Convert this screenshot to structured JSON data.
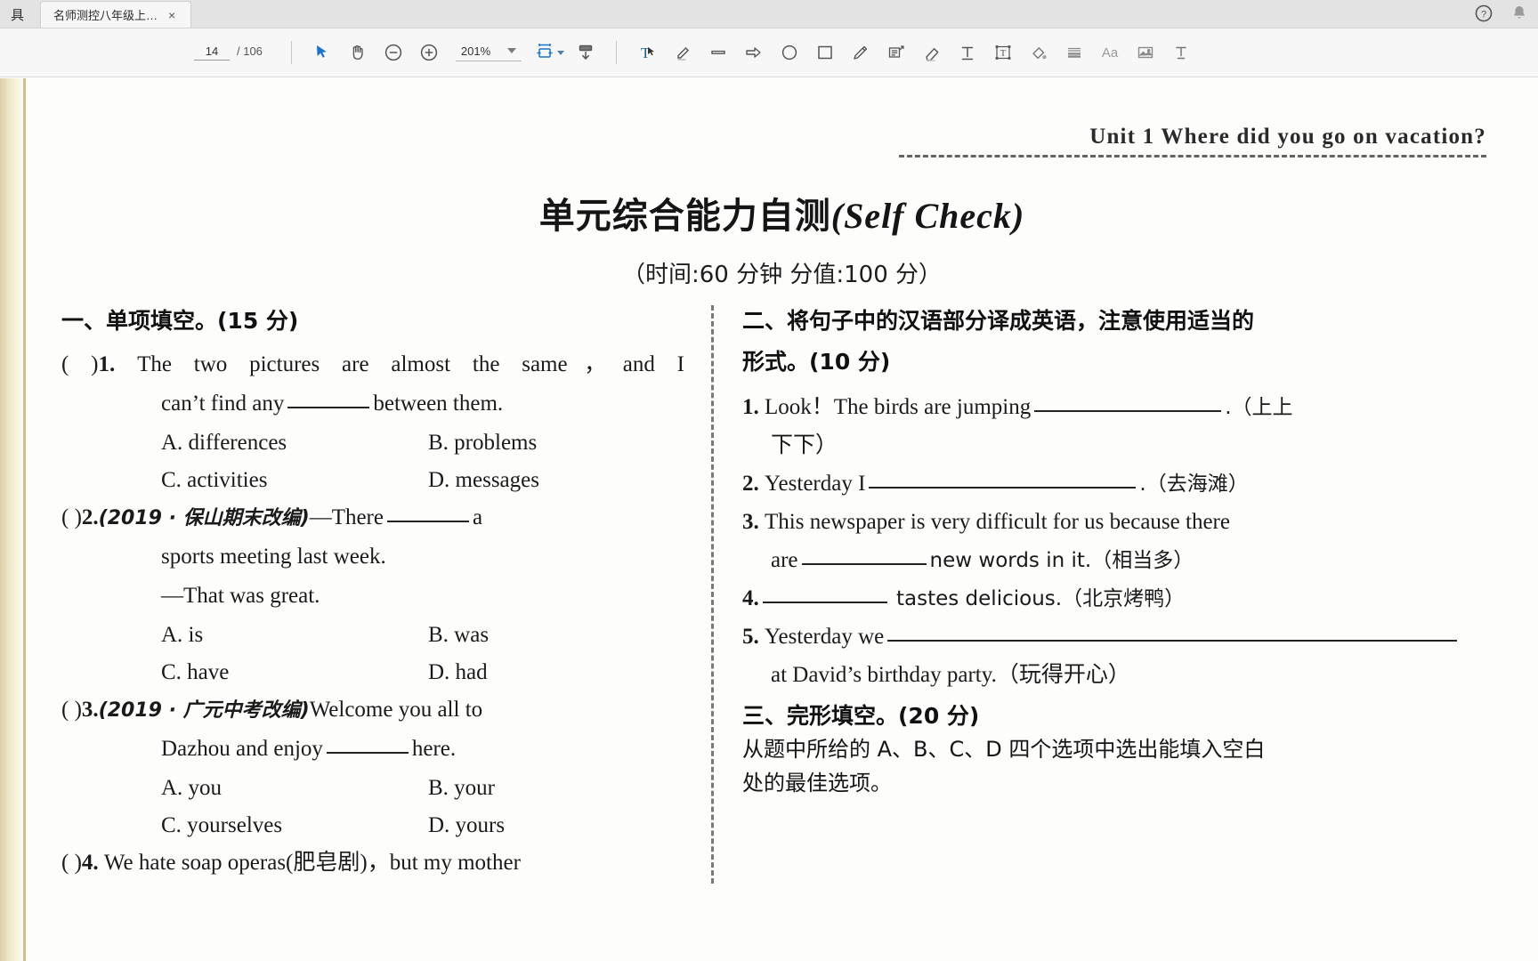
{
  "window": {
    "menu_tail": "具",
    "tab_title": "名师测控八年级上…",
    "tab_close": "×",
    "help_icon": "help-circle-icon",
    "bell_icon": "bell-icon"
  },
  "toolbar": {
    "page_current": "14",
    "page_total": "/ 106",
    "zoom_value": "201%",
    "icons": [
      "select-cursor-icon",
      "hand-pan-icon",
      "zoom-out-icon",
      "zoom-in-icon",
      "fit-page-icon",
      "download-icon",
      "text-select-icon",
      "highlighter-icon",
      "line-icon",
      "arrow-icon",
      "ellipse-icon",
      "rectangle-icon",
      "pencil-icon",
      "note-callout-icon",
      "eraser-icon",
      "text-insert-icon",
      "text-box-icon",
      "fill-color-icon",
      "strikethrough-lines-icon",
      "font-size-icon",
      "image-insert-icon",
      "text-underline-icon"
    ]
  },
  "document": {
    "header_unit": "Unit 1    Where did you go on vacation?",
    "title_cn": "单元综合能力自测",
    "title_en": "Self Check",
    "title_open_paren": "(",
    "title_close_paren": ")",
    "subtitle": "（时间:60 分钟    分值:100 分）",
    "left_column": {
      "section_heading": "一、单项填空。(15 分)",
      "questions": [
        {
          "marker": "(      )",
          "num": "1.",
          "line1": "The  two  pictures  are  almost  the  same，and  I",
          "line2_pre": "can’t find any",
          "line2_post": "between them.",
          "options": [
            "A. differences",
            "B. problems",
            "C. activities",
            "D. messages"
          ]
        },
        {
          "marker": "(      )",
          "num": "2.",
          "source": "(2019 · 保山期末改编)",
          "line1_pre": "—There",
          "line1_post": "a",
          "line2": "sports meeting last week.",
          "line3": "—That was great.",
          "options": [
            "A. is",
            "B. was",
            "C. have",
            "D. had"
          ]
        },
        {
          "marker": "(      )",
          "num": "3.",
          "source": "(2019 · 广元中考改编)",
          "line1_post": "Welcome  you  all  to",
          "line2_pre": "Dazhou and enjoy",
          "line2_post": "here.",
          "options": [
            "A. you",
            "B. your",
            "C. yourselves",
            "D. yours"
          ]
        },
        {
          "marker": "(      )",
          "num": "4.",
          "line1": "We hate soap operas(肥皂剧)，but my mother"
        }
      ]
    },
    "right_column": {
      "section2_heading_l1": "二、将句子中的汉语部分译成英语，注意使用适当的",
      "section2_heading_l2": "形式。(10 分)",
      "items": [
        {
          "num": "1.",
          "line1_pre": "Look！The  birds  are  jumping",
          "line1_post": ".（上上",
          "line2": "下下）"
        },
        {
          "num": "2.",
          "pre": "Yesterday I",
          "post": ".（去海滩）"
        },
        {
          "num": "3.",
          "line1": "This  newspaper  is  very  difficult  for  us  because  there",
          "line2_pre": "are",
          "line2_post": "new words in it.（相当多）"
        },
        {
          "num": "4.",
          "post": "tastes delicious.（北京烤鸭）"
        },
        {
          "num": "5.",
          "line1_pre": "Yesterday we",
          "line2": "at David’s birthday party.（玩得开心）"
        }
      ],
      "section3_heading": "三、完形填空。(20 分)",
      "section3_body_l1": "从题中所给的 A、B、C、D 四个选项中选出能填入空白",
      "section3_body_l2": "处的最佳选项。"
    }
  },
  "colors": {
    "accent": "#1a73c8",
    "chrome": "#e3e3e3",
    "toolbar": "#f7f7f7",
    "paper": "#fdfdfc",
    "binding": "#d8cfa8"
  }
}
